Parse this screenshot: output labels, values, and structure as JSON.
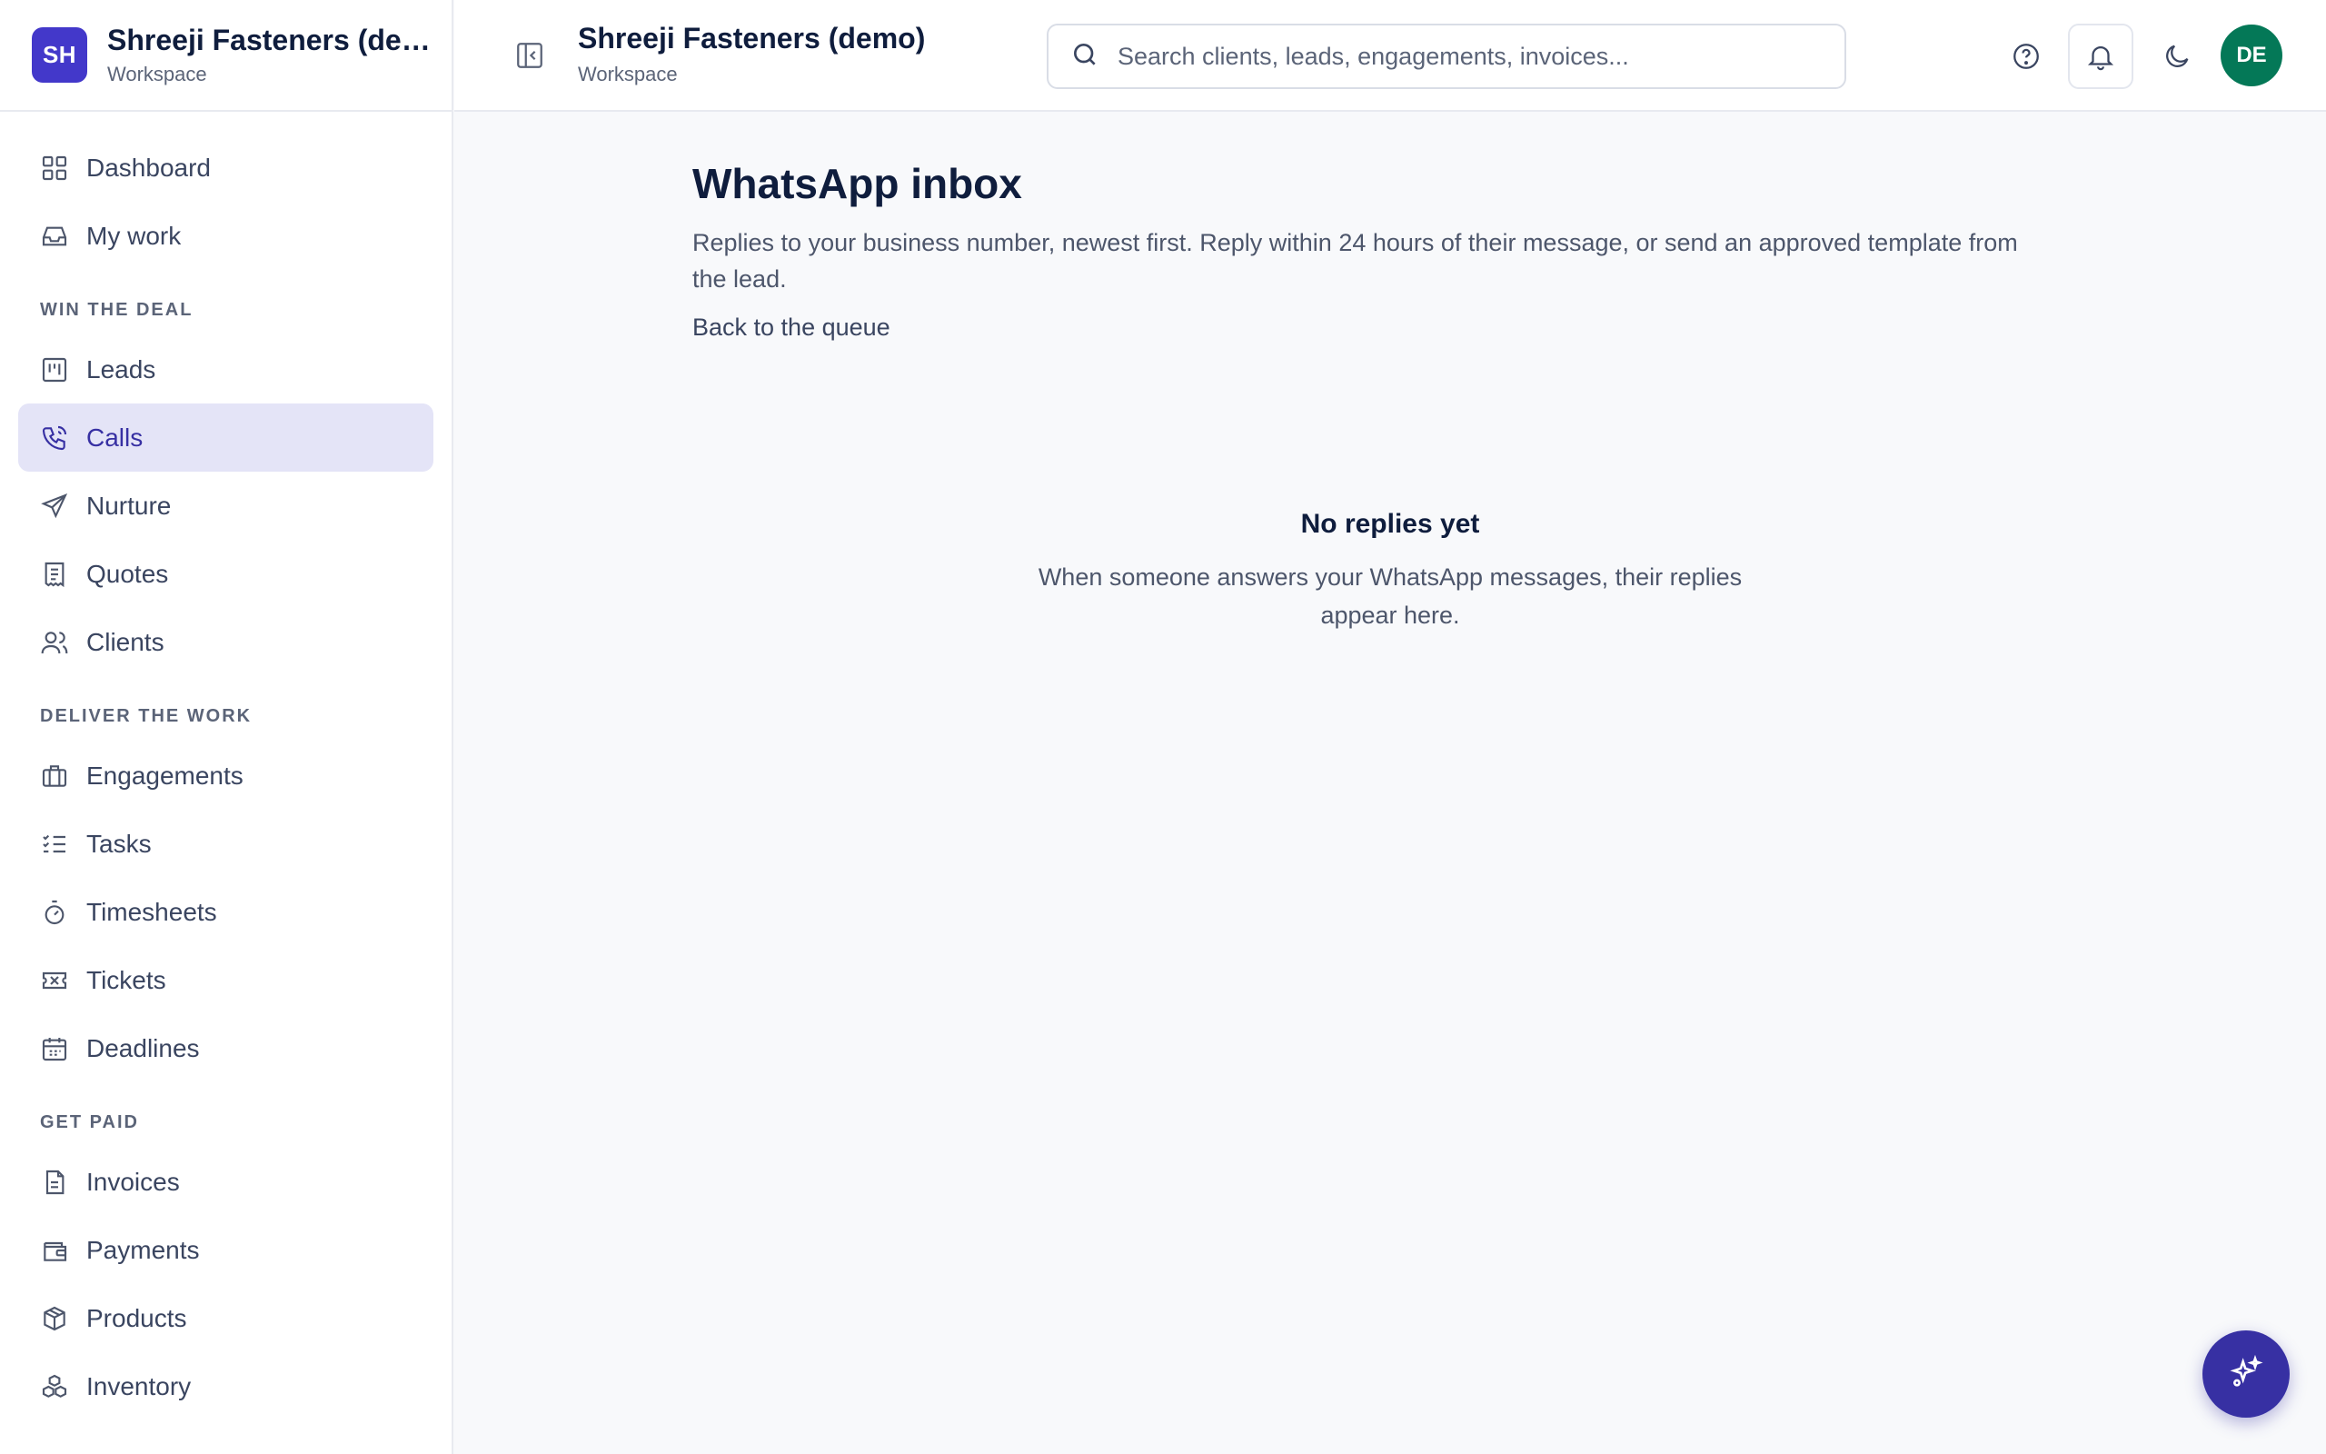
{
  "brand": {
    "initials": "SH",
    "name": "Shreeji Fasteners (dem...",
    "subtitle": "Workspace",
    "color": "#4338ca"
  },
  "header": {
    "title": "Shreeji Fasteners (demo)",
    "subtitle": "Workspace",
    "search_placeholder": "Search clients, leads, engagements, invoices...",
    "avatar_initials": "DE",
    "avatar_color": "#047857",
    "icons": [
      "sidebar-collapse-icon",
      "search-icon",
      "help-icon",
      "bell-icon",
      "moon-icon"
    ]
  },
  "sidebar": {
    "top_items": [
      {
        "label": "Dashboard",
        "icon": "grid-icon"
      },
      {
        "label": "My work",
        "icon": "inbox-icon"
      }
    ],
    "sections": [
      {
        "label": "WIN THE DEAL",
        "items": [
          {
            "label": "Leads",
            "icon": "kanban-icon"
          },
          {
            "label": "Calls",
            "icon": "phone-icon",
            "active": true
          },
          {
            "label": "Nurture",
            "icon": "send-icon"
          },
          {
            "label": "Quotes",
            "icon": "receipt-icon"
          },
          {
            "label": "Clients",
            "icon": "users-icon"
          }
        ]
      },
      {
        "label": "DELIVER THE WORK",
        "items": [
          {
            "label": "Engagements",
            "icon": "briefcase-icon"
          },
          {
            "label": "Tasks",
            "icon": "checklist-icon"
          },
          {
            "label": "Timesheets",
            "icon": "stopwatch-icon"
          },
          {
            "label": "Tickets",
            "icon": "ticket-icon"
          },
          {
            "label": "Deadlines",
            "icon": "calendar-icon"
          }
        ]
      },
      {
        "label": "GET PAID",
        "items": [
          {
            "label": "Invoices",
            "icon": "file-icon"
          },
          {
            "label": "Payments",
            "icon": "wallet-icon"
          },
          {
            "label": "Products",
            "icon": "package-icon"
          },
          {
            "label": "Inventory",
            "icon": "boxes-icon"
          }
        ]
      }
    ],
    "active_color": "#3730a3"
  },
  "main": {
    "title": "WhatsApp inbox",
    "description": "Replies to your business number, newest first. Reply within 24 hours of their message, or send an approved template from the lead.",
    "back_link": "Back to the queue",
    "empty_title": "No replies yet",
    "empty_description": "When someone answers your WhatsApp messages, their replies appear here."
  },
  "fab": {
    "icon": "sparkles-icon",
    "color": "#3730a3"
  }
}
